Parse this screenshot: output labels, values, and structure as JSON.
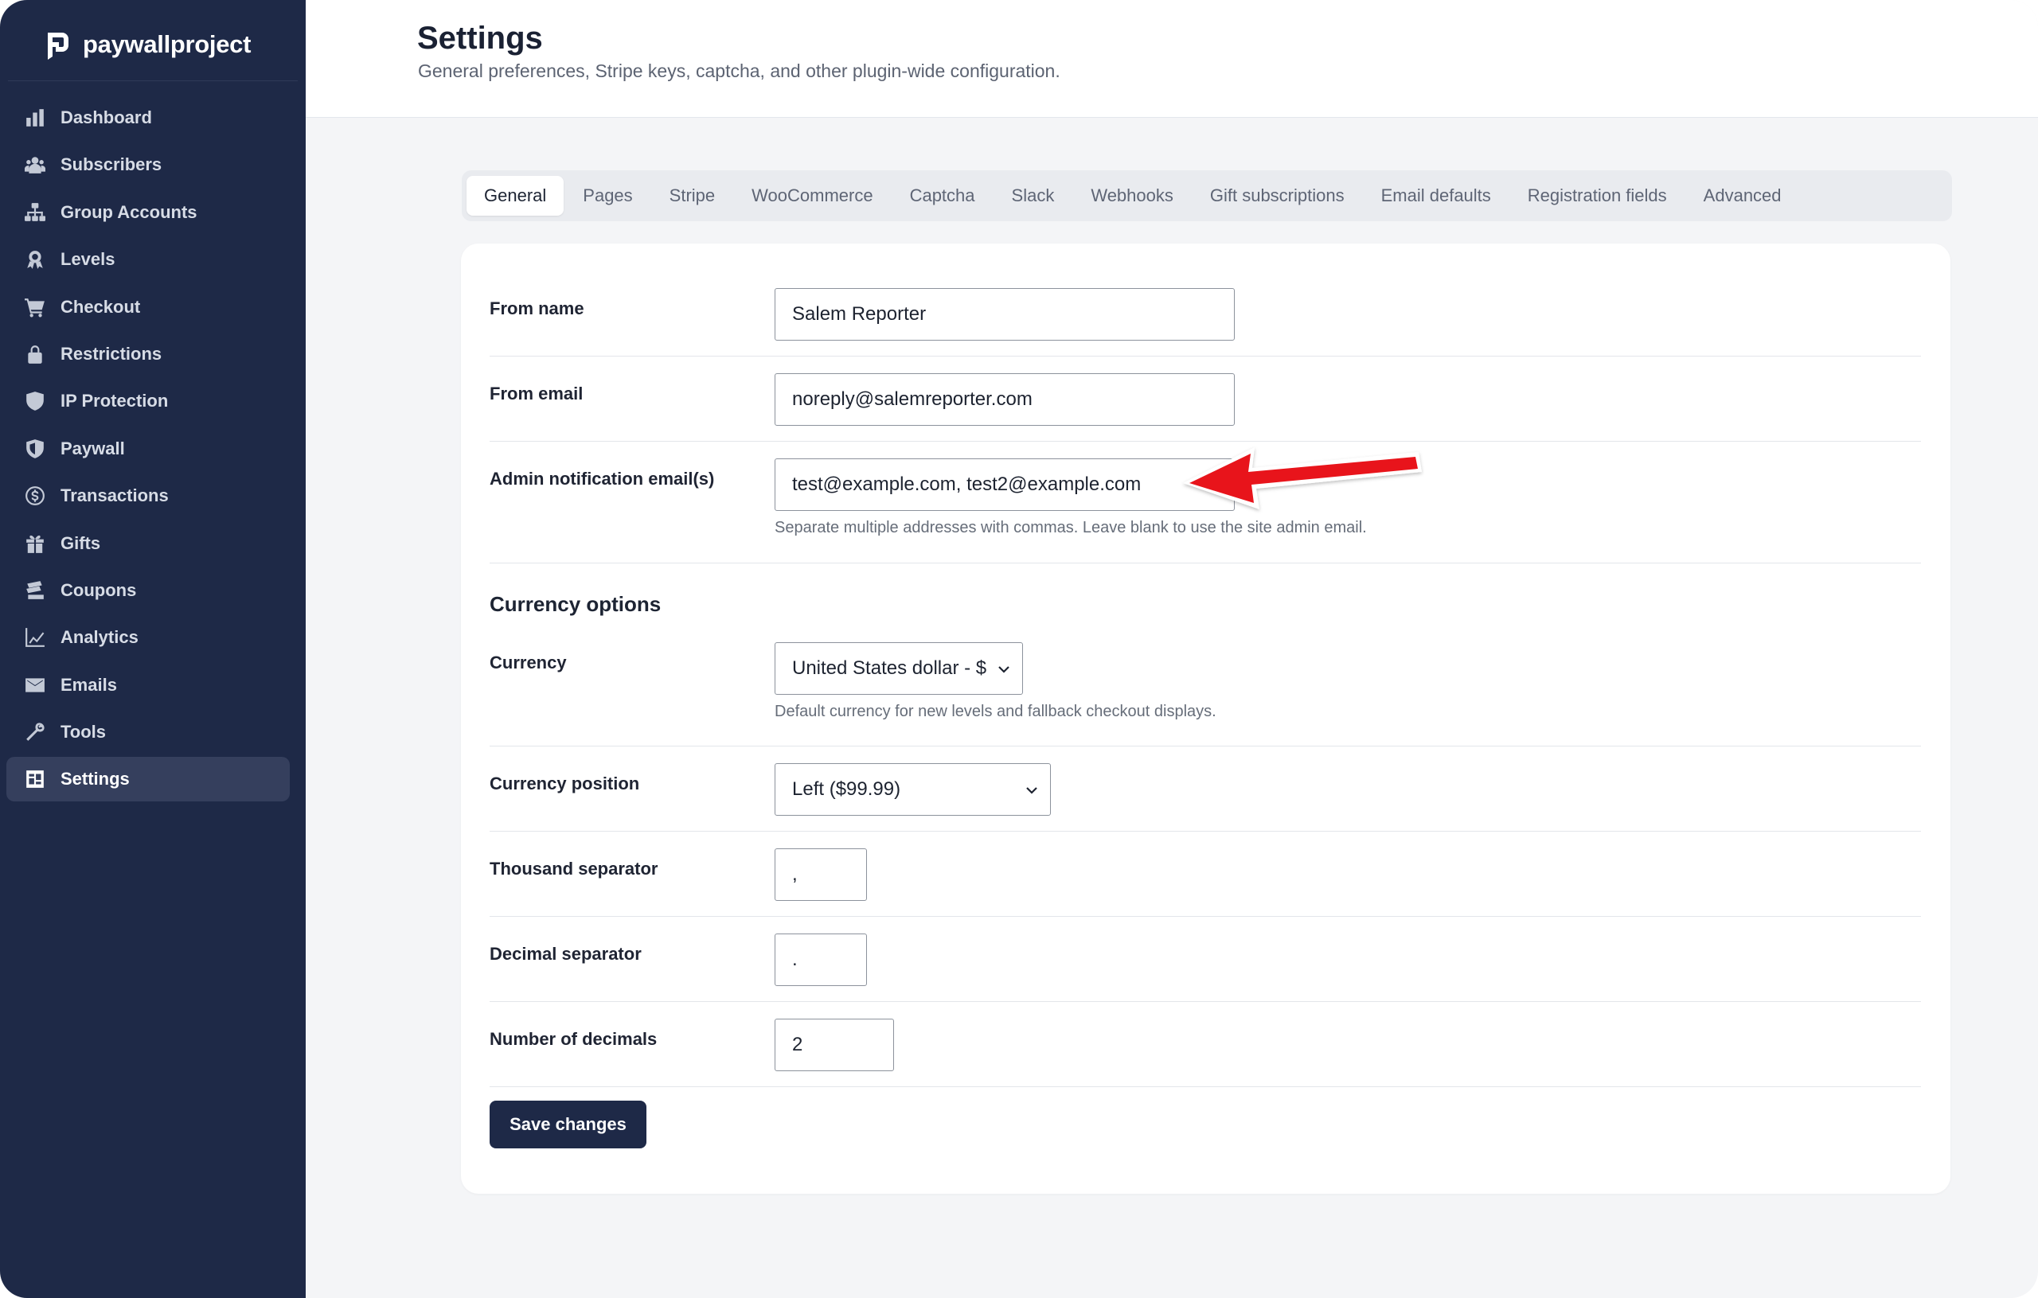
{
  "brand": {
    "name": "paywallproject"
  },
  "sidebar": {
    "items": [
      {
        "label": "Dashboard",
        "icon": "bar-chart-icon"
      },
      {
        "label": "Subscribers",
        "icon": "users-icon"
      },
      {
        "label": "Group Accounts",
        "icon": "sitemap-icon"
      },
      {
        "label": "Levels",
        "icon": "award-icon"
      },
      {
        "label": "Checkout",
        "icon": "cart-icon"
      },
      {
        "label": "Restrictions",
        "icon": "lock-icon"
      },
      {
        "label": "IP Protection",
        "icon": "shield-icon"
      },
      {
        "label": "Paywall",
        "icon": "shield-lock-icon"
      },
      {
        "label": "Transactions",
        "icon": "dollar-circle-icon"
      },
      {
        "label": "Gifts",
        "icon": "gift-icon"
      },
      {
        "label": "Coupons",
        "icon": "coupons-icon"
      },
      {
        "label": "Analytics",
        "icon": "line-chart-icon"
      },
      {
        "label": "Emails",
        "icon": "envelope-icon"
      },
      {
        "label": "Tools",
        "icon": "wrench-icon"
      },
      {
        "label": "Settings",
        "icon": "settings-icon",
        "active": true
      }
    ]
  },
  "header": {
    "title": "Settings",
    "subtitle": "General preferences, Stripe keys, captcha, and other plugin-wide configuration."
  },
  "tabs": [
    {
      "label": "General",
      "active": true
    },
    {
      "label": "Pages"
    },
    {
      "label": "Stripe"
    },
    {
      "label": "WooCommerce"
    },
    {
      "label": "Captcha"
    },
    {
      "label": "Slack"
    },
    {
      "label": "Webhooks"
    },
    {
      "label": "Gift subscriptions"
    },
    {
      "label": "Email defaults"
    },
    {
      "label": "Registration fields"
    },
    {
      "label": "Advanced"
    }
  ],
  "form": {
    "from_name": {
      "label": "From name",
      "value": "Salem Reporter"
    },
    "from_email": {
      "label": "From email",
      "value": "noreply@salemreporter.com"
    },
    "admin_emails": {
      "label": "Admin notification email(s)",
      "value": "test@example.com, test2@example.com",
      "help": "Separate multiple addresses with commas. Leave blank to use the site admin email."
    },
    "currency_section": "Currency options",
    "currency": {
      "label": "Currency",
      "value": "United States dollar - $",
      "help": "Default currency for new levels and fallback checkout displays."
    },
    "currency_position": {
      "label": "Currency position",
      "value": "Left ($99.99)"
    },
    "thousand_separator": {
      "label": "Thousand separator",
      "value": ","
    },
    "decimal_separator": {
      "label": "Decimal separator",
      "value": "."
    },
    "decimals": {
      "label": "Number of decimals",
      "value": "2"
    },
    "save_label": "Save changes"
  },
  "colors": {
    "sidebar": "#1e2947",
    "accent": "#1e2947",
    "annotation_arrow": "#e8141b"
  }
}
